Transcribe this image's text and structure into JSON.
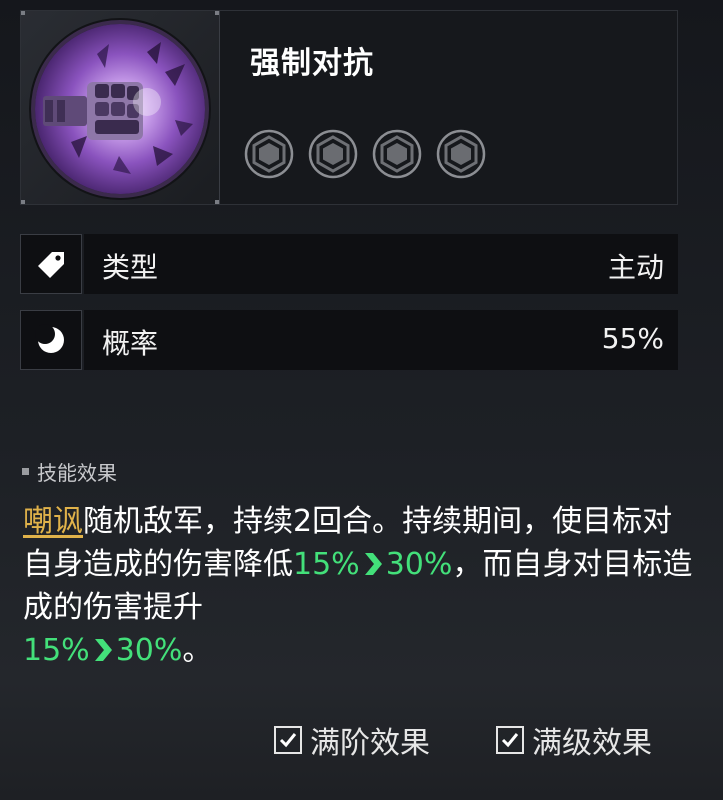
{
  "skill": {
    "name": "强制对抗",
    "portrait_icon": "purple-fist-icon",
    "rank_gems": [
      {
        "icon": "hexagon-gem-icon",
        "filled": false
      },
      {
        "icon": "hexagon-gem-icon",
        "filled": false
      },
      {
        "icon": "hexagon-gem-icon",
        "filled": false
      },
      {
        "icon": "hexagon-gem-icon",
        "filled": false
      }
    ]
  },
  "info_rows": [
    {
      "icon": "tag-icon",
      "label": "类型",
      "value": "主动"
    },
    {
      "icon": "crescent-moon-icon",
      "label": "概率",
      "value": "55%"
    }
  ],
  "effect": {
    "section_title": "技能效果",
    "keyword": "嘲讽",
    "text_1": "随机敌军，持续2回合。持续期间，使目标对自身造成的伤害降低",
    "from_1": "15%",
    "to_1": "30%",
    "text_2": "，而自身对目标造成的伤害提升",
    "from_2": "15%",
    "to_2": "30%",
    "text_3": "。"
  },
  "toggles": [
    {
      "label": "满阶效果",
      "checked": true
    },
    {
      "label": "满级效果",
      "checked": true
    }
  ],
  "colors": {
    "keyword": "#e0b24a",
    "highlight": "#43e07a",
    "panel": "#0e0f12"
  }
}
